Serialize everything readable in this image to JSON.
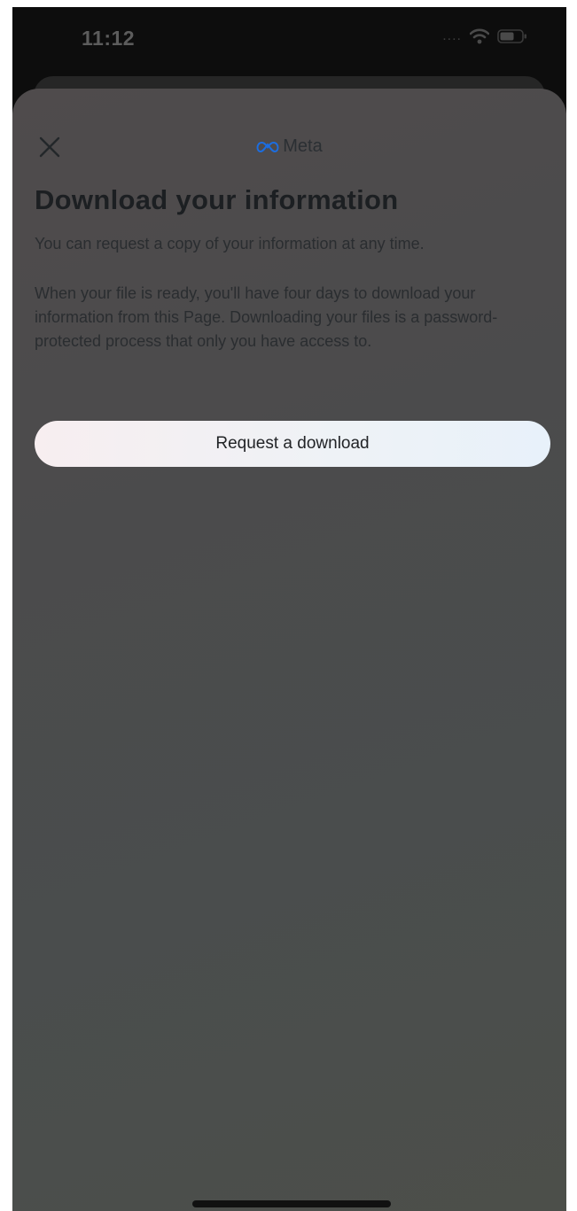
{
  "status_bar": {
    "time": "11:12",
    "signal": "....",
    "icons": [
      "wifi-icon",
      "battery-icon"
    ]
  },
  "sheet": {
    "close_icon": "close-icon",
    "brand": {
      "logo_icon": "meta-infinity-icon",
      "label": "Meta",
      "logo_color": "#1c6de0"
    },
    "title": "Download your information",
    "intro": "You can request a copy of your information at any time.",
    "detail": "When your file is ready, you'll have four days to download your information from this Page. Downloading your files is a password-protected process that only you have access to.",
    "request_button_label": "Request a download"
  },
  "colors": {
    "sheet_background": "#4b4b4c",
    "button_background": "#eef2f6",
    "text": "#2a2d30"
  }
}
